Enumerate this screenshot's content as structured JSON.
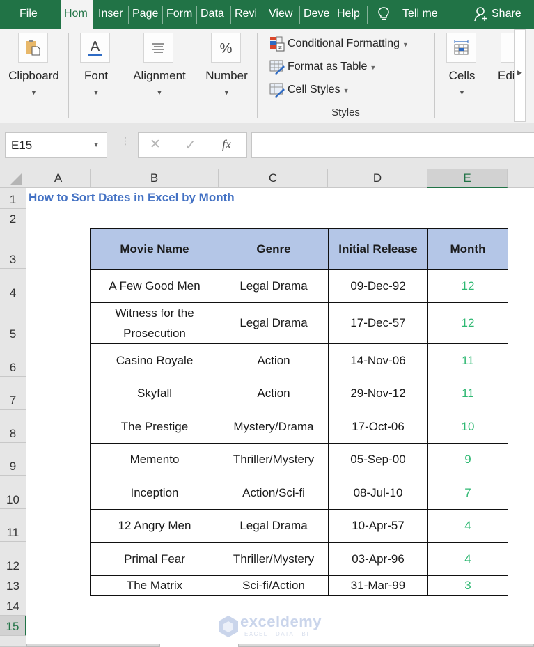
{
  "tabs": [
    {
      "label": "File",
      "active": false
    },
    {
      "label": "Hom",
      "active": true
    },
    {
      "label": "Inser",
      "active": false
    },
    {
      "label": "Page",
      "active": false
    },
    {
      "label": "Form",
      "active": false
    },
    {
      "label": "Data",
      "active": false
    },
    {
      "label": "Revi",
      "active": false
    },
    {
      "label": "View",
      "active": false
    },
    {
      "label": "Deve",
      "active": false
    },
    {
      "label": "Help",
      "active": false
    }
  ],
  "tell_me": "Tell me",
  "share": "Share",
  "ribbon": {
    "clipboard": "Clipboard",
    "font": "Font",
    "alignment": "Alignment",
    "number": "Number",
    "conditional_formatting": "Conditional Formatting",
    "format_as_table": "Format as Table",
    "cell_styles": "Cell Styles",
    "styles_group": "Styles",
    "cells": "Cells",
    "editing": "Edi",
    "number_glyph": "%",
    "font_glyph": "A"
  },
  "formula_bar": {
    "name_box": "E15",
    "fx": "fx",
    "cancel": "✕",
    "enter": "✓",
    "value": ""
  },
  "columns": [
    "A",
    "B",
    "C",
    "D",
    "E"
  ],
  "selected_column": "E",
  "rows": [
    "1",
    "2",
    "3",
    "4",
    "5",
    "6",
    "7",
    "8",
    "9",
    "10",
    "11",
    "12",
    "13",
    "14",
    "15"
  ],
  "selected_row": "15",
  "sheet": {
    "title": "How to Sort Dates in Excel by Month",
    "headers": [
      "Movie Name",
      "Genre",
      "Initial Release",
      "Month"
    ],
    "records": [
      {
        "name": "A Few Good Men",
        "genre": "Legal Drama",
        "release": "09-Dec-92",
        "month": "12"
      },
      {
        "name": "Witness for the Prosecution",
        "genre": "Legal Drama",
        "release": "17-Dec-57",
        "month": "12"
      },
      {
        "name": "Casino Royale",
        "genre": "Action",
        "release": "14-Nov-06",
        "month": "11"
      },
      {
        "name": "Skyfall",
        "genre": "Action",
        "release": "29-Nov-12",
        "month": "11"
      },
      {
        "name": "The Prestige",
        "genre": "Mystery/Drama",
        "release": "17-Oct-06",
        "month": "10"
      },
      {
        "name": "Memento",
        "genre": "Thriller/Mystery",
        "release": "05-Sep-00",
        "month": "9"
      },
      {
        "name": "Inception",
        "genre": "Action/Sci-fi",
        "release": "08-Jul-10",
        "month": "7"
      },
      {
        "name": "12 Angry Men",
        "genre": "Legal Drama",
        "release": "10-Apr-57",
        "month": "4"
      },
      {
        "name": "Primal Fear",
        "genre": "Thriller/Mystery",
        "release": "03-Apr-96",
        "month": "4"
      },
      {
        "name": "The Matrix",
        "genre": "Sci-fi/Action",
        "release": "31-Mar-99",
        "month": "3"
      }
    ]
  },
  "watermark": {
    "brand": "exceldemy",
    "tagline": "EXCEL · DATA · BI"
  },
  "colors": {
    "accent": "#217346",
    "header_fill": "#b4c6e7",
    "title": "#4472c4",
    "month_text": "#2eb872"
  }
}
